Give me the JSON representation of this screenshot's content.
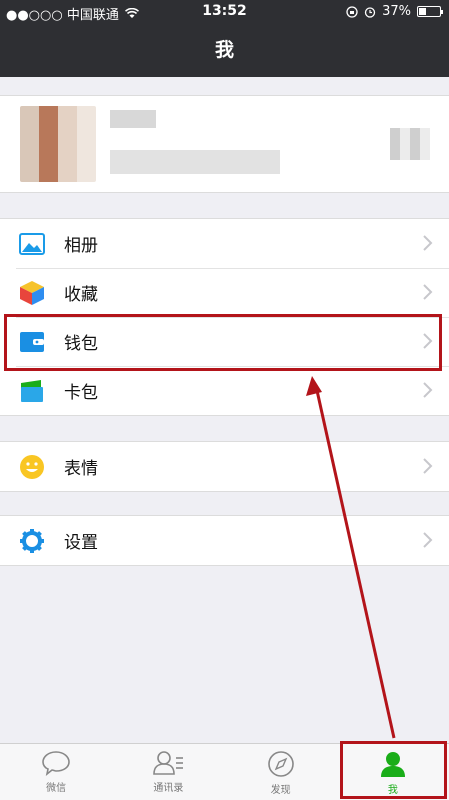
{
  "status_bar": {
    "carrier": "●●○○○ 中国联通",
    "time": "13:52",
    "battery": "37%",
    "battery_level": 0.37
  },
  "nav": {
    "title": "我"
  },
  "menu": {
    "group1": [
      {
        "label": "相册",
        "icon": "album-icon"
      },
      {
        "label": "收藏",
        "icon": "favorites-icon"
      },
      {
        "label": "钱包",
        "icon": "wallet-icon"
      },
      {
        "label": "卡包",
        "icon": "card-pack-icon"
      }
    ],
    "group2": [
      {
        "label": "表情",
        "icon": "sticker-icon"
      }
    ],
    "group3": [
      {
        "label": "设置",
        "icon": "settings-icon"
      }
    ]
  },
  "tabbar": {
    "tabs": [
      {
        "label": "微信",
        "icon": "chat-icon"
      },
      {
        "label": "通讯录",
        "icon": "contacts-icon"
      },
      {
        "label": "发现",
        "icon": "compass-icon"
      },
      {
        "label": "我",
        "icon": "me-icon",
        "active": true
      }
    ]
  },
  "colors": {
    "accent": "#1aad19",
    "highlight": "#b3141a",
    "navbar": "#2e2f33"
  }
}
